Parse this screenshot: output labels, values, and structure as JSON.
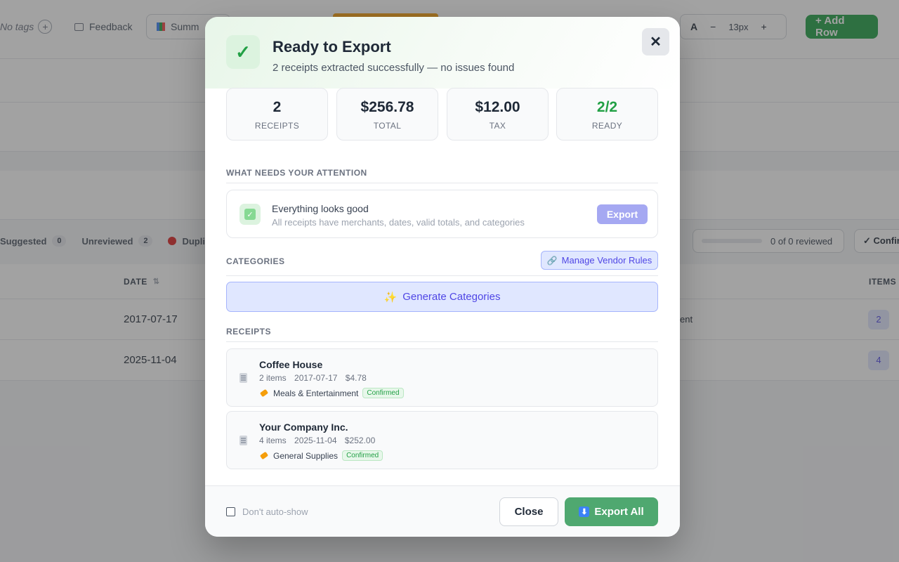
{
  "toolbar": {
    "no_tags": "No tags",
    "feedback": "Feedback",
    "summary": "Summ",
    "font_icon": "A",
    "font_size": "13px",
    "minus": "−",
    "plus": "+",
    "add_row": "+ Add Row"
  },
  "filters": {
    "suggested": "Suggested",
    "suggested_count": "0",
    "unreviewed": "Unreviewed",
    "unreviewed_count": "2",
    "duplicates": "Dupli",
    "reviewed": "0 of 0 reviewed",
    "confirm": "✓ Confir"
  },
  "table": {
    "date_header": "DATE",
    "sort_icon": "⇅",
    "items_header": "ITEMS",
    "rows": [
      {
        "date": "2017-07-17",
        "category_fragment": "ent",
        "items": "2"
      },
      {
        "date": "2025-11-04",
        "category_fragment": "",
        "items": "4"
      }
    ]
  },
  "modal": {
    "check": "✓",
    "title": "Ready to Export",
    "subtitle": "2 receipts extracted successfully — no issues found",
    "close_icon": "✕",
    "stats": [
      {
        "value": "2",
        "label": "RECEIPTS"
      },
      {
        "value": "$256.78",
        "label": "TOTAL"
      },
      {
        "value": "$12.00",
        "label": "TAX"
      },
      {
        "value": "2/2",
        "label": "READY"
      }
    ],
    "attention": {
      "section": "WHAT NEEDS YOUR ATTENTION",
      "title": "Everything looks good",
      "description": "All receipts have merchants, dates, valid totals, and categories",
      "check": "✓",
      "export": "Export"
    },
    "categories": {
      "section": "CATEGORIES",
      "manage_vendor_rules": "Manage Vendor Rules",
      "link_icon": "🔗",
      "sparkle_icon": "✨",
      "generate": "Generate Categories"
    },
    "receipts": {
      "section": "RECEIPTS",
      "items": [
        {
          "merchant": "Coffee House",
          "items": "2 items",
          "date": "2017-07-17",
          "amount": "$4.78",
          "category": "Meals & Entertainment",
          "status": "Confirmed"
        },
        {
          "merchant": "Your Company Inc.",
          "items": "4 items",
          "date": "2025-11-04",
          "amount": "$252.00",
          "category": "General Supplies",
          "status": "Confirmed"
        }
      ]
    },
    "footer": {
      "dont_auto_show": "Don't auto-show",
      "close": "Close",
      "download_icon": "⬇",
      "export_all": "Export All"
    }
  }
}
